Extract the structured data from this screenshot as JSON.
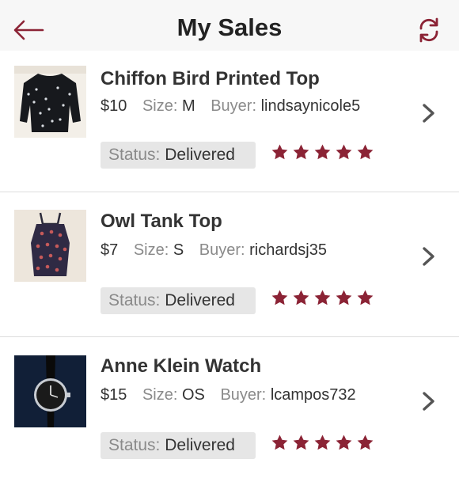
{
  "header": {
    "title": "My Sales"
  },
  "colors": {
    "accent": "#8b2335",
    "star": "#8b2335"
  },
  "labels": {
    "size": "Size:",
    "buyer": "Buyer:",
    "status": "Status:"
  },
  "sales": [
    {
      "name": "Chiffon Bird Printed Top",
      "price": "$10",
      "size": "M",
      "buyer": "lindsaynicole5",
      "status": "Delivered",
      "rating": 5
    },
    {
      "name": "Owl Tank Top",
      "price": "$7",
      "size": "S",
      "buyer": "richardsj35",
      "status": "Delivered",
      "rating": 5
    },
    {
      "name": "Anne Klein Watch",
      "price": "$15",
      "size": "OS",
      "buyer": "lcampos732",
      "status": "Delivered",
      "rating": 5
    }
  ]
}
